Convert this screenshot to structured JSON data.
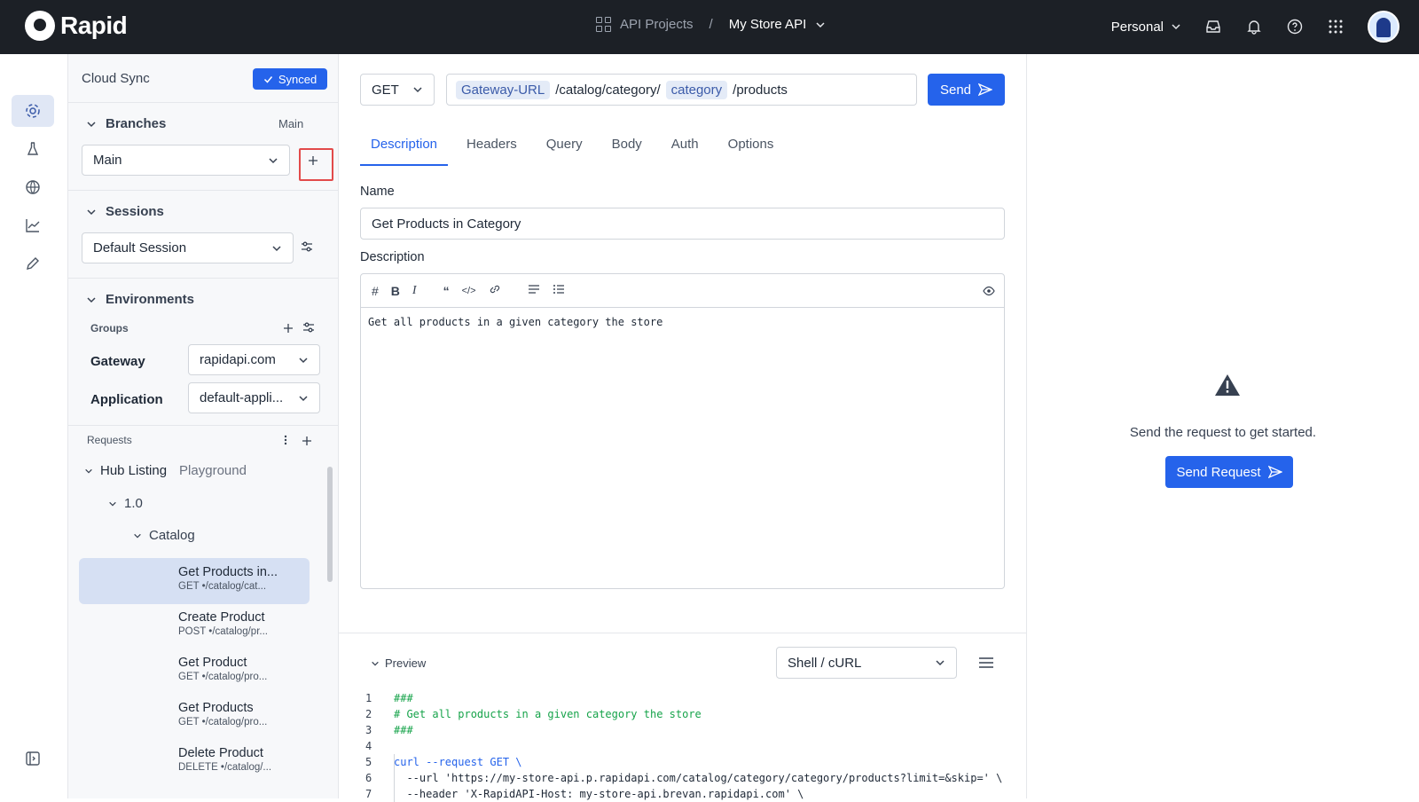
{
  "brand": {
    "name": "Rapid"
  },
  "topbar": {
    "projects_label": "API Projects",
    "separator": "/",
    "current_project": "My Store API",
    "workspace": "Personal"
  },
  "sidebar": {
    "cloud_sync": "Cloud Sync",
    "synced": "Synced",
    "branches": {
      "title": "Branches",
      "current": "Main",
      "selected": "Main"
    },
    "sessions": {
      "title": "Sessions",
      "selected": "Default Session"
    },
    "environments": {
      "title": "Environments",
      "groups_label": "Groups",
      "gateway_label": "Gateway",
      "gateway_value": "rapidapi.com",
      "application_label": "Application",
      "application_value": "default-appli..."
    },
    "requests": {
      "title": "Requests",
      "hub_listing": "Hub Listing",
      "playground": "Playground",
      "version": "1.0",
      "folder": "Catalog",
      "items": [
        {
          "title": "Get Products in...",
          "method": "GET •/catalog/cat..."
        },
        {
          "title": "Create Product",
          "method": "POST •/catalog/pr..."
        },
        {
          "title": "Get Product",
          "method": "GET •/catalog/pro..."
        },
        {
          "title": "Get Products",
          "method": "GET •/catalog/pro..."
        },
        {
          "title": "Delete Product",
          "method": "DELETE •/catalog/..."
        }
      ]
    }
  },
  "request": {
    "method": "GET",
    "url_var1": "Gateway-URL",
    "url_part1": "/catalog/category/",
    "url_var2": "category",
    "url_part2": "/products",
    "send_label": "Send",
    "tabs": [
      "Description",
      "Headers",
      "Query",
      "Body",
      "Auth",
      "Options"
    ],
    "name_label": "Name",
    "name_value": "Get Products in Category",
    "description_label": "Description",
    "description_text": "Get all products in a given category the store"
  },
  "preview": {
    "label": "Preview",
    "language": "Shell / cURL",
    "lines": [
      {
        "n": "1",
        "text": "###"
      },
      {
        "n": "2",
        "text": "# Get all products in a given category the store"
      },
      {
        "n": "3",
        "text": "###"
      },
      {
        "n": "4",
        "text": ""
      },
      {
        "n": "5",
        "text": "curl --request GET \\"
      },
      {
        "n": "6",
        "text": "  --url 'https://my-store-api.p.rapidapi.com/catalog/category/category/products?limit=&skip=' \\"
      },
      {
        "n": "7",
        "text": "  --header 'X-RapidAPI-Host: my-store-api.brevan.rapidapi.com' \\"
      }
    ]
  },
  "response": {
    "hint": "Send the request to get started.",
    "button": "Send Request"
  }
}
